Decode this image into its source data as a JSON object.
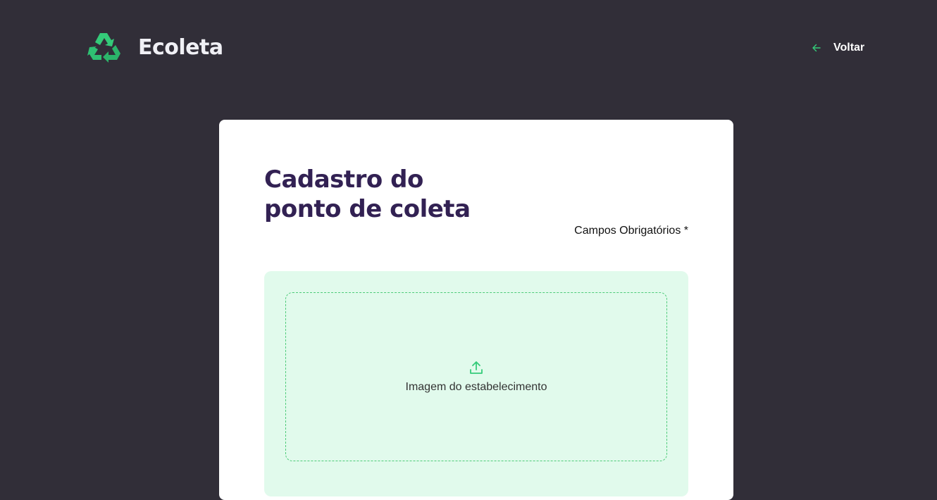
{
  "header": {
    "logo_icon": "recycle-icon",
    "app_name": "Ecoleta",
    "back_icon": "arrow-left-icon",
    "back_label": "Voltar"
  },
  "form": {
    "title_line1": "Cadastro do",
    "title_line2": "ponto de coleta",
    "required_note": "Campos Obrigatórios *",
    "dropzone": {
      "icon": "upload-icon",
      "label": "Imagem do estabelecimento"
    }
  },
  "colors": {
    "background": "#312e38",
    "accent": "#34cb79",
    "title": "#322153",
    "dropzone_bg": "#e1faec"
  }
}
